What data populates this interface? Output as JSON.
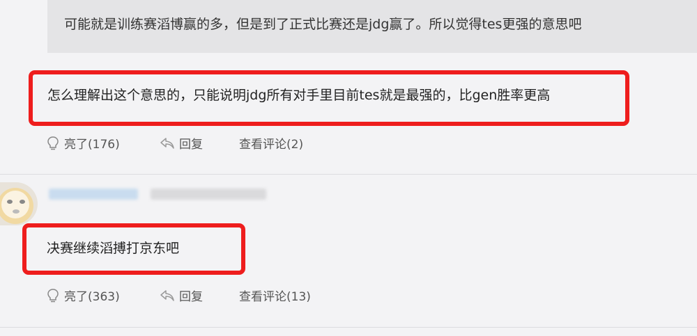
{
  "quoted_comment": {
    "text": "可能就是训练赛滔博赢的多，但是到了正式比赛还是jdg赢了。所以觉得tes更强的意思吧"
  },
  "reply_1": {
    "text": "怎么理解出这个意思的，只能说明jdg所有对手里目前tes就是最强的，比gen胜率更高",
    "actions": {
      "like_label": "亮了(176)",
      "reply_label": "回复",
      "view_comments_label": "查看评论(2)"
    }
  },
  "reply_2": {
    "text": "决赛继续滔搏打京东吧",
    "actions": {
      "like_label": "亮了(363)",
      "reply_label": "回复",
      "view_comments_label": "查看评论(13)"
    }
  },
  "colors": {
    "highlight_border": "#ee1d1d",
    "quote_background": "#e4e4e6",
    "page_background": "#f3f3f5"
  },
  "icons": {
    "like": "lightbulb-icon",
    "reply": "reply-arrow-icon"
  }
}
